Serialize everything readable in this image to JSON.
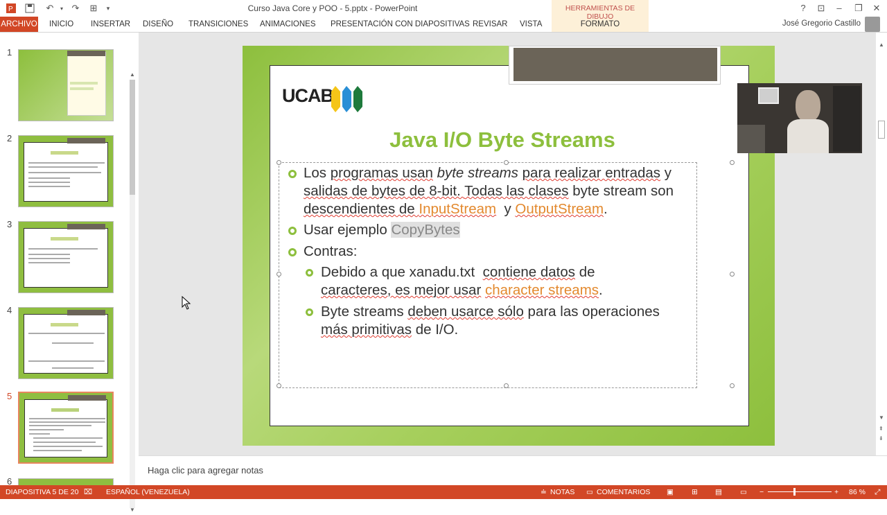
{
  "window": {
    "title": "Curso Java Core y POO - 5.pptx - PowerPoint",
    "tools_band": "HERRAMIENTAS DE DIBUJO"
  },
  "ribbon": {
    "tabs": [
      "ARCHIVO",
      "INICIO",
      "INSERTAR",
      "DISEÑO",
      "TRANSICIONES",
      "ANIMACIONES",
      "PRESENTACIÓN CON DIAPOSITIVAS",
      "REVISAR",
      "VISTA",
      "FORMATO"
    ]
  },
  "user": {
    "name": "José Gregorio Castillo"
  },
  "thumbnails": [
    {
      "num": "1"
    },
    {
      "num": "2"
    },
    {
      "num": "3"
    },
    {
      "num": "4"
    },
    {
      "num": "5"
    },
    {
      "num": "6"
    }
  ],
  "slide": {
    "logo_text": "UCAB",
    "title": "Java I/O Byte Streams",
    "b1_pre": "Los ",
    "b1_w1": "programas usan",
    "b1_it": " byte streams ",
    "b1_w2": "para realizar entradas",
    "b1_w3": " y",
    "b1_l2a": "salidas de bytes de 8-bit. ",
    "b1_l2b": "Todas las clases",
    "b1_l2c": " byte stream son",
    "b1_l3a": "descendientes de ",
    "b1_link1": "InputStream",
    "b1_y": "  y ",
    "b1_link2": "OutputStream",
    "b1_end": ".",
    "b2_pre": "Usar ejemplo ",
    "b2_hl": "CopyBytes",
    "b3": "Contras:",
    "s1_a": "Debido a que xanadu.txt  ",
    "s1_b": "contiene datos",
    "s1_c": " de",
    "s1_l2a": "caracteres, es mejor usar",
    "s1_link": "character streams",
    "s1_end": ".",
    "s2_a": "Byte streams ",
    "s2_b": "deben usarce sólo",
    "s2_c": " para las operaciones",
    "s2_l2a": "más primitivas",
    "s2_l2b": " de I/O."
  },
  "notes": {
    "placeholder": "Haga clic para agregar notas"
  },
  "status": {
    "slide": "DIAPOSITIVA 5 DE 20",
    "lang": "ESPAÑOL (VENEZUELA)",
    "notes": "NOTAS",
    "comments": "COMENTARIOS",
    "zoom": "86 %"
  }
}
